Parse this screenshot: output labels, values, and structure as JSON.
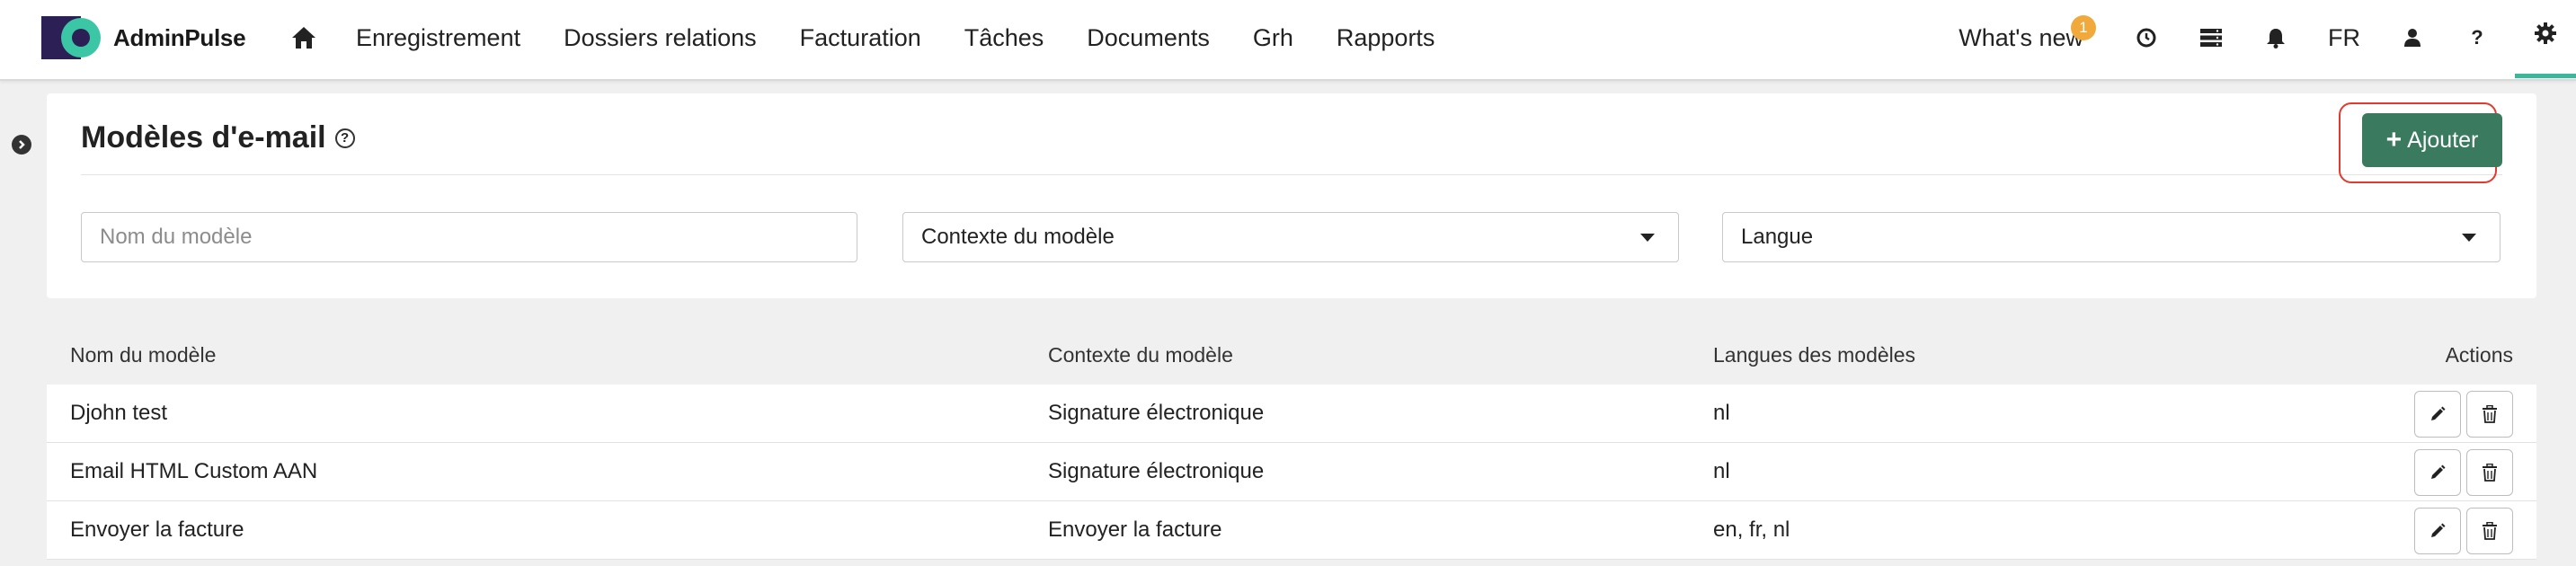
{
  "app": {
    "logo_text": "AdminPulse"
  },
  "nav": {
    "home_icon": "home-icon",
    "items": [
      "Enregistrement",
      "Dossiers relations",
      "Facturation",
      "Tâches",
      "Documents",
      "Grh",
      "Rapports"
    ]
  },
  "right_nav": {
    "whats_new": "What's new",
    "whats_new_badge": "1",
    "language": "FR",
    "icons": [
      "clock-icon",
      "server-icon",
      "bell-icon",
      "user-icon",
      "help-icon",
      "gear-icon"
    ]
  },
  "page": {
    "title": "Modèles d'e-mail",
    "help_symbol": "?",
    "add_button_label": "Ajouter",
    "add_button_plus": "+"
  },
  "filters": {
    "name_placeholder": "Nom du modèle",
    "context_value": "Contexte du modèle",
    "language_value": "Langue"
  },
  "table": {
    "headers": [
      "Nom du modèle",
      "Contexte du modèle",
      "Langues des modèles",
      "Actions"
    ],
    "rows": [
      {
        "name": "Djohn test",
        "context": "Signature électronique",
        "languages": "nl"
      },
      {
        "name": "Email HTML Custom AAN",
        "context": "Signature électronique",
        "languages": "nl"
      },
      {
        "name": "Envoyer la facture",
        "context": "Envoyer la facture",
        "languages": "en, fr, nl"
      }
    ]
  },
  "colors": {
    "accent": "#3a7a5f",
    "highlight_outline": "#e33a2f",
    "badge": "#f2a93b",
    "logo_dark": "#2b1f55",
    "logo_teal": "#3bc7a5"
  }
}
